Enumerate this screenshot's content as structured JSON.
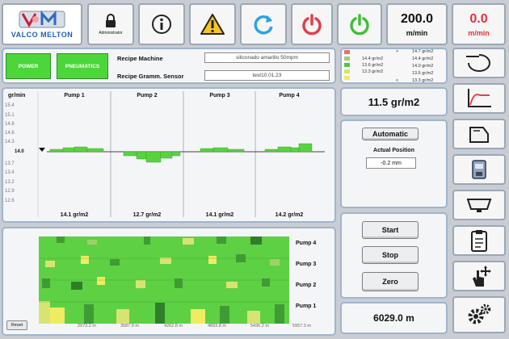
{
  "header": {
    "logo_text": "VALCO MELTON",
    "user_label": "Administrator",
    "line_speed": {
      "value": "200.0",
      "unit": "m/min"
    },
    "applicator_speed": {
      "value": "0.0",
      "unit": "m/min"
    },
    "buttons": [
      "user-lock",
      "info",
      "alarm-warning",
      "refresh-cycle",
      "power-off-red",
      "power-on-green"
    ]
  },
  "recipe": {
    "power_label": "POWER",
    "pneumatics_label": "PNEUMATICS",
    "machine_label": "Recipe Machine",
    "machine_value": "siliconado amarillo 50mpm",
    "gramm_label": "Recipe Gramm. Sensor",
    "gramm_value": "test10.01.23"
  },
  "legend": {
    "rows": [
      {
        "sign": ">",
        "value": "14.7 gr/m2",
        "color": "#e8706c"
      },
      {
        "sign": "",
        "value": "14.4 gr/m2",
        "from": "14.4 gr/m2",
        "color": "#9bd36a"
      },
      {
        "sign": "",
        "value": "14.0 gr/m2",
        "from": "13.6 gr/m2",
        "color": "#55c63f"
      },
      {
        "sign": "",
        "value": "13.6 gr/m2",
        "from": "13.3 gr/m2",
        "color": "#d7e474"
      },
      {
        "sign": "<",
        "value": "13.3 gr/m2",
        "color": "#f0ec62"
      }
    ]
  },
  "average": {
    "value": "11.5 gr/m2"
  },
  "position": {
    "mode_label": "Automatic",
    "actual_label": "Actual Position",
    "actual_value": "-0.2 mm"
  },
  "controls": {
    "start": "Start",
    "stop": "Stop",
    "zero": "Zero"
  },
  "distance": {
    "value": "6029.0 m"
  },
  "pumps_chart": {
    "unit_label": "gr/min",
    "y_ticks": [
      "15.4",
      "15.1",
      "14.8",
      "14.6",
      "14.3",
      "14.0",
      "13.7",
      "13.4",
      "13.2",
      "12.9",
      "12.6"
    ],
    "pumps": [
      {
        "title": "Pump 1",
        "value": "14.1 gr/m2"
      },
      {
        "title": "Pump 2",
        "value": "12.7 gr/m2"
      },
      {
        "title": "Pump 3",
        "value": "14.1 gr/m2"
      },
      {
        "title": "Pump 4",
        "value": "14.2 gr/m2"
      }
    ]
  },
  "heatmap": {
    "reset_label": "Reset",
    "rows": [
      "Pump 4",
      "Pump 3",
      "Pump 2",
      "Pump 1"
    ],
    "x_labels": [
      "2973.2 m",
      "3587.0 m",
      "4262.8 m",
      "4893.8 m",
      "5436.2 m",
      "5957.3 m"
    ]
  },
  "sidebar": {
    "items": [
      "dosing-curve",
      "ramp-chart",
      "applicator-head",
      "pump-unit",
      "nozzle-tray",
      "clipboard-report",
      "touch-move",
      "settings-gears"
    ]
  },
  "colors": {
    "green_bar": "#57d33f",
    "panel_border": "#9fb4cc",
    "speed_red": "#e0303a"
  }
}
